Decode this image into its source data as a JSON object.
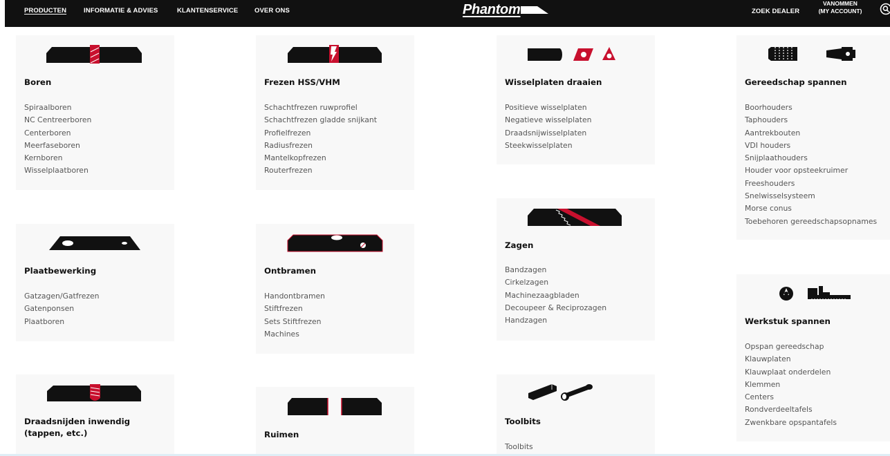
{
  "nav": {
    "links": [
      "PRODUCTEN",
      "INFORMATIE & ADVIES",
      "KLANTENSERVICE",
      "OVER ONS"
    ],
    "logo": "Phantom",
    "dealer": "ZOEK DEALER",
    "account_line1": "VANOMMEN",
    "account_line2": "(MY ACCOUNT)",
    "search_icon": "magnifier-icon"
  },
  "categories": {
    "boren": {
      "title": "Boren",
      "items": [
        "Spiraalboren",
        "NC Centreerboren",
        "Centerboren",
        "Meerfaseboren",
        "Kernboren",
        "Wisselplaatboren"
      ]
    },
    "frezen": {
      "title": "Frezen HSS/VHM",
      "items": [
        "Schachtfrezen ruwprofiel",
        "Schachtfrezen gladde snijkant",
        "Profielfrezen",
        "Radiusfrezen",
        "Mantelkopfrezen",
        "Routerfrezen"
      ]
    },
    "wisselplaten": {
      "title": "Wisselplaten draaien",
      "items": [
        "Positieve wisselplaten",
        "Negatieve wisselplaten",
        "Draadsnijwisselplaten",
        "Steekwisselplaten"
      ]
    },
    "gereedschap": {
      "title": "Gereedschap spannen",
      "items": [
        "Boorhouders",
        "Taphouders",
        "Aantrekbouten",
        "VDI houders",
        "Snijplaathouders",
        "Houder voor opsteekruimer",
        "Freeshouders",
        "Snelwisselsysteem",
        "Morse conus",
        "Toebehoren gereedschapsopnames"
      ]
    },
    "plaatbewerking": {
      "title": "Plaatbewerking",
      "items": [
        "Gatzagen/Gatfrezen",
        "Gatenponsen",
        "Plaatboren"
      ]
    },
    "ontbramen": {
      "title": "Ontbramen",
      "items": [
        "Handontbramen",
        "Stiftfrezen",
        "Sets Stiftfrezen",
        "Machines"
      ]
    },
    "zagen": {
      "title": "Zagen",
      "items": [
        "Bandzagen",
        "Cirkelzagen",
        "Machinezaagbladen",
        "Decoupeer & Reciprozagen",
        "Handzagen"
      ]
    },
    "werkstuk": {
      "title": "Werkstuk spannen",
      "items": [
        "Opspan gereedschap",
        "Klauwplaten",
        "Klauwplaat onderdelen",
        "Klemmen",
        "Centers",
        "Rondverdeeltafels",
        "Zwenkbare opspantafels"
      ]
    },
    "draadsnijden": {
      "title": "Draadsnijden inwendig (tappen, etc.)",
      "items": []
    },
    "ruimen": {
      "title": "Ruimen",
      "items": []
    },
    "toolbits": {
      "title": "Toolbits",
      "items": [
        "Toolbits"
      ]
    }
  },
  "colors": {
    "accent": "#c8102e",
    "bar": "#111111",
    "card": "#f8f8f8",
    "item_text": "#555555"
  }
}
